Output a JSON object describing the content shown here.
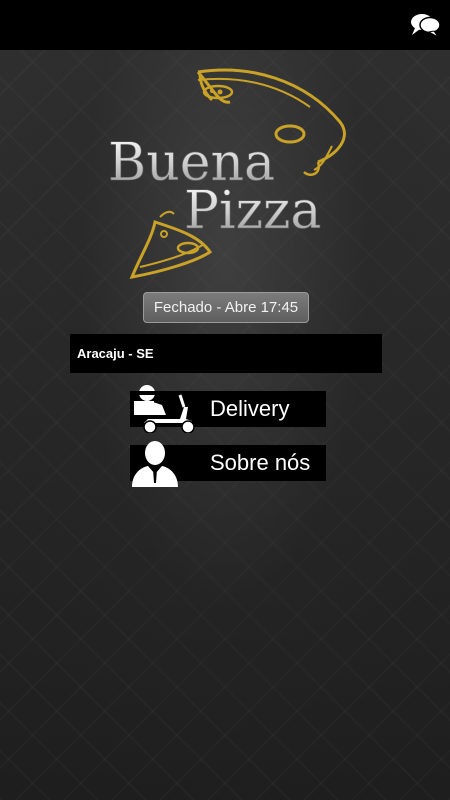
{
  "brand": {
    "line1": "Buena",
    "line2": "Pizza",
    "gold": "#c9a227"
  },
  "status": {
    "text": "Fechado - Abre 17:45"
  },
  "location": {
    "text": "Aracaju - SE"
  },
  "menu": {
    "delivery_label": "Delivery",
    "about_label": "Sobre nós"
  },
  "icons": {
    "chat": "chat-bubbles-icon",
    "delivery": "delivery-scooter-icon",
    "about": "person-silhouette-icon"
  }
}
